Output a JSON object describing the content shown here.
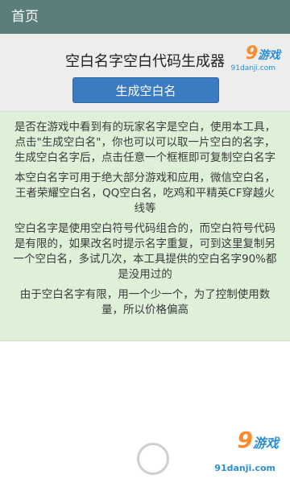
{
  "header": {
    "title": "首页"
  },
  "brand": {
    "name": "游戏",
    "digit": "9",
    "url": "91danji.com"
  },
  "main": {
    "title": "空白名字空白代码生成器",
    "generate_button": "生成空白名"
  },
  "info": {
    "paragraphs": [
      "是否在游戏中看到有的玩家名字是空白，使用本工具，点击\"生成空白名\"，你也可以可以取一片空白的名字，生成空白名字后，点击任意一个框框即可复制空白名字",
      "本空白名字可用于绝大部分游戏和应用，微信空白名，王者荣耀空白名，QQ空白名，吃鸡和平精英CF穿越火线等",
      "空白名字是使用空白符号代码组合的，而空白符号代码是有限的，如果改名时提示名字重复，可到这里复制另一个空白名，多试几次，本工具提供的空白名字90%都是没用过的",
      "由于空白名字有限，用一个少一个，为了控制使用数量，所以价格偏高"
    ]
  },
  "colors": {
    "topbar": "#5a7f7b",
    "button": "#3b7bbf",
    "info_bg": "#dff0d8"
  }
}
